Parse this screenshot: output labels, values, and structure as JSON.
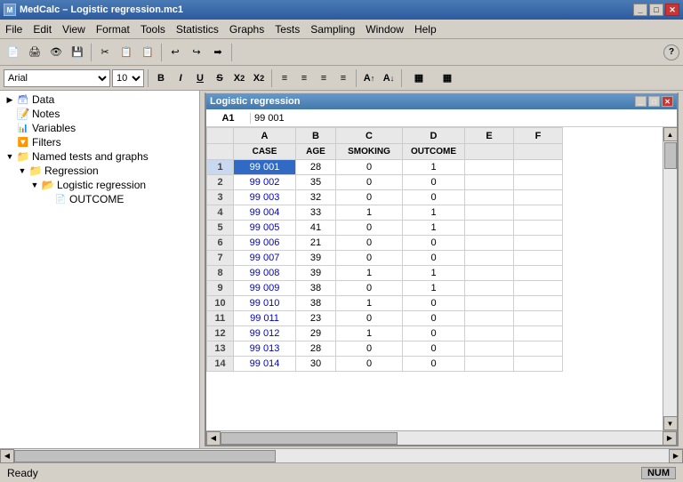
{
  "app": {
    "title": "MedCalc – Logistic regression.mc1",
    "icon": "MC"
  },
  "menu": {
    "items": [
      "File",
      "Edit",
      "View",
      "Format",
      "Tools",
      "Statistics",
      "Graphs",
      "Tests",
      "Sampling",
      "Window",
      "Help"
    ]
  },
  "toolbar": {
    "buttons": [
      "📄",
      "🖨",
      "👁",
      "💾",
      "📋",
      "✂",
      "📋",
      "📋",
      "↩",
      "↩",
      "➡",
      "❓"
    ]
  },
  "formatbar": {
    "font": "Arial",
    "size": "10",
    "buttons": [
      "B",
      "I",
      "U",
      "S",
      "X₂",
      "X²",
      "≡",
      "≡",
      "≡",
      "≡",
      "A",
      "A"
    ]
  },
  "tree": {
    "items": [
      {
        "label": "Data",
        "level": 0,
        "icon": "data",
        "expand": "▶"
      },
      {
        "label": "Notes",
        "level": 0,
        "icon": "notes",
        "expand": ""
      },
      {
        "label": "Variables",
        "level": 0,
        "icon": "variables",
        "expand": ""
      },
      {
        "label": "Filters",
        "level": 0,
        "icon": "filters",
        "expand": ""
      },
      {
        "label": "Named tests and graphs",
        "level": 0,
        "icon": "folder",
        "expand": "▼"
      },
      {
        "label": "Regression",
        "level": 1,
        "icon": "folder",
        "expand": "▼"
      },
      {
        "label": "Logistic regression",
        "level": 2,
        "icon": "folder",
        "expand": "▼"
      },
      {
        "label": "OUTCOME",
        "level": 3,
        "icon": "doc",
        "expand": ""
      }
    ]
  },
  "spreadsheet": {
    "title": "Logistic regression",
    "cell_ref": "A1",
    "cell_value": "99 001",
    "columns": [
      {
        "label": "A",
        "subheader": "CASE"
      },
      {
        "label": "B",
        "subheader": "AGE"
      },
      {
        "label": "C",
        "subheader": "SMOKING"
      },
      {
        "label": "D",
        "subheader": "OUTCOME"
      },
      {
        "label": "E",
        "subheader": ""
      },
      {
        "label": "F",
        "subheader": ""
      }
    ],
    "rows": [
      {
        "num": 1,
        "A": "99 001",
        "B": "28",
        "C": "0",
        "D": "1",
        "E": "",
        "F": "",
        "selected": true
      },
      {
        "num": 2,
        "A": "99 002",
        "B": "35",
        "C": "0",
        "D": "0",
        "E": "",
        "F": ""
      },
      {
        "num": 3,
        "A": "99 003",
        "B": "32",
        "C": "0",
        "D": "0",
        "E": "",
        "F": ""
      },
      {
        "num": 4,
        "A": "99 004",
        "B": "33",
        "C": "1",
        "D": "1",
        "E": "",
        "F": ""
      },
      {
        "num": 5,
        "A": "99 005",
        "B": "41",
        "C": "0",
        "D": "1",
        "E": "",
        "F": ""
      },
      {
        "num": 6,
        "A": "99 006",
        "B": "21",
        "C": "0",
        "D": "0",
        "E": "",
        "F": ""
      },
      {
        "num": 7,
        "A": "99 007",
        "B": "39",
        "C": "0",
        "D": "0",
        "E": "",
        "F": ""
      },
      {
        "num": 8,
        "A": "99 008",
        "B": "39",
        "C": "1",
        "D": "1",
        "E": "",
        "F": ""
      },
      {
        "num": 9,
        "A": "99 009",
        "B": "38",
        "C": "0",
        "D": "1",
        "E": "",
        "F": ""
      },
      {
        "num": 10,
        "A": "99 010",
        "B": "38",
        "C": "1",
        "D": "0",
        "E": "",
        "F": ""
      },
      {
        "num": 11,
        "A": "99 011",
        "B": "23",
        "C": "0",
        "D": "0",
        "E": "",
        "F": ""
      },
      {
        "num": 12,
        "A": "99 012",
        "B": "29",
        "C": "1",
        "D": "0",
        "E": "",
        "F": ""
      },
      {
        "num": 13,
        "A": "99 013",
        "B": "28",
        "C": "0",
        "D": "0",
        "E": "",
        "F": ""
      },
      {
        "num": 14,
        "A": "99 014",
        "B": "30",
        "C": "0",
        "D": "0",
        "E": "",
        "F": ""
      }
    ]
  },
  "status": {
    "text": "Ready",
    "indicator": "NUM"
  }
}
